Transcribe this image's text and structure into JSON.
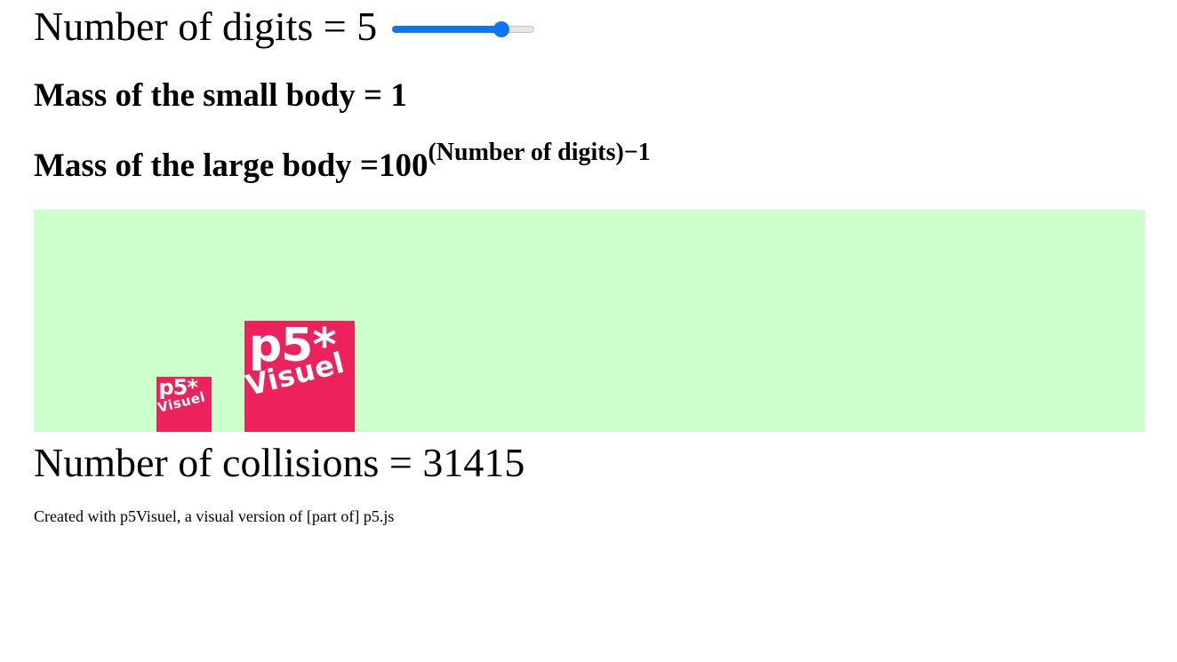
{
  "digits": {
    "label": "Number of digits = 5",
    "slider": {
      "min": 1,
      "max": 6,
      "value": 5
    }
  },
  "mass_small": {
    "label": "Mass of the small body = 1"
  },
  "mass_large": {
    "label": "Mass of the large body =",
    "base": "100",
    "exponent": "(Number of digits)−1"
  },
  "canvas": {
    "background": "#ccffcc",
    "block_color": "#ed225d",
    "small_block": {
      "logo_top": "p5*",
      "logo_bottom": "Visuel"
    },
    "large_block": {
      "logo_top": "p5*",
      "logo_bottom": "Visuel"
    }
  },
  "collisions": {
    "label": "Number of collisions = 31415"
  },
  "footer": {
    "text": "Created with p5Visuel, a visual version of [part of] p5.js"
  }
}
